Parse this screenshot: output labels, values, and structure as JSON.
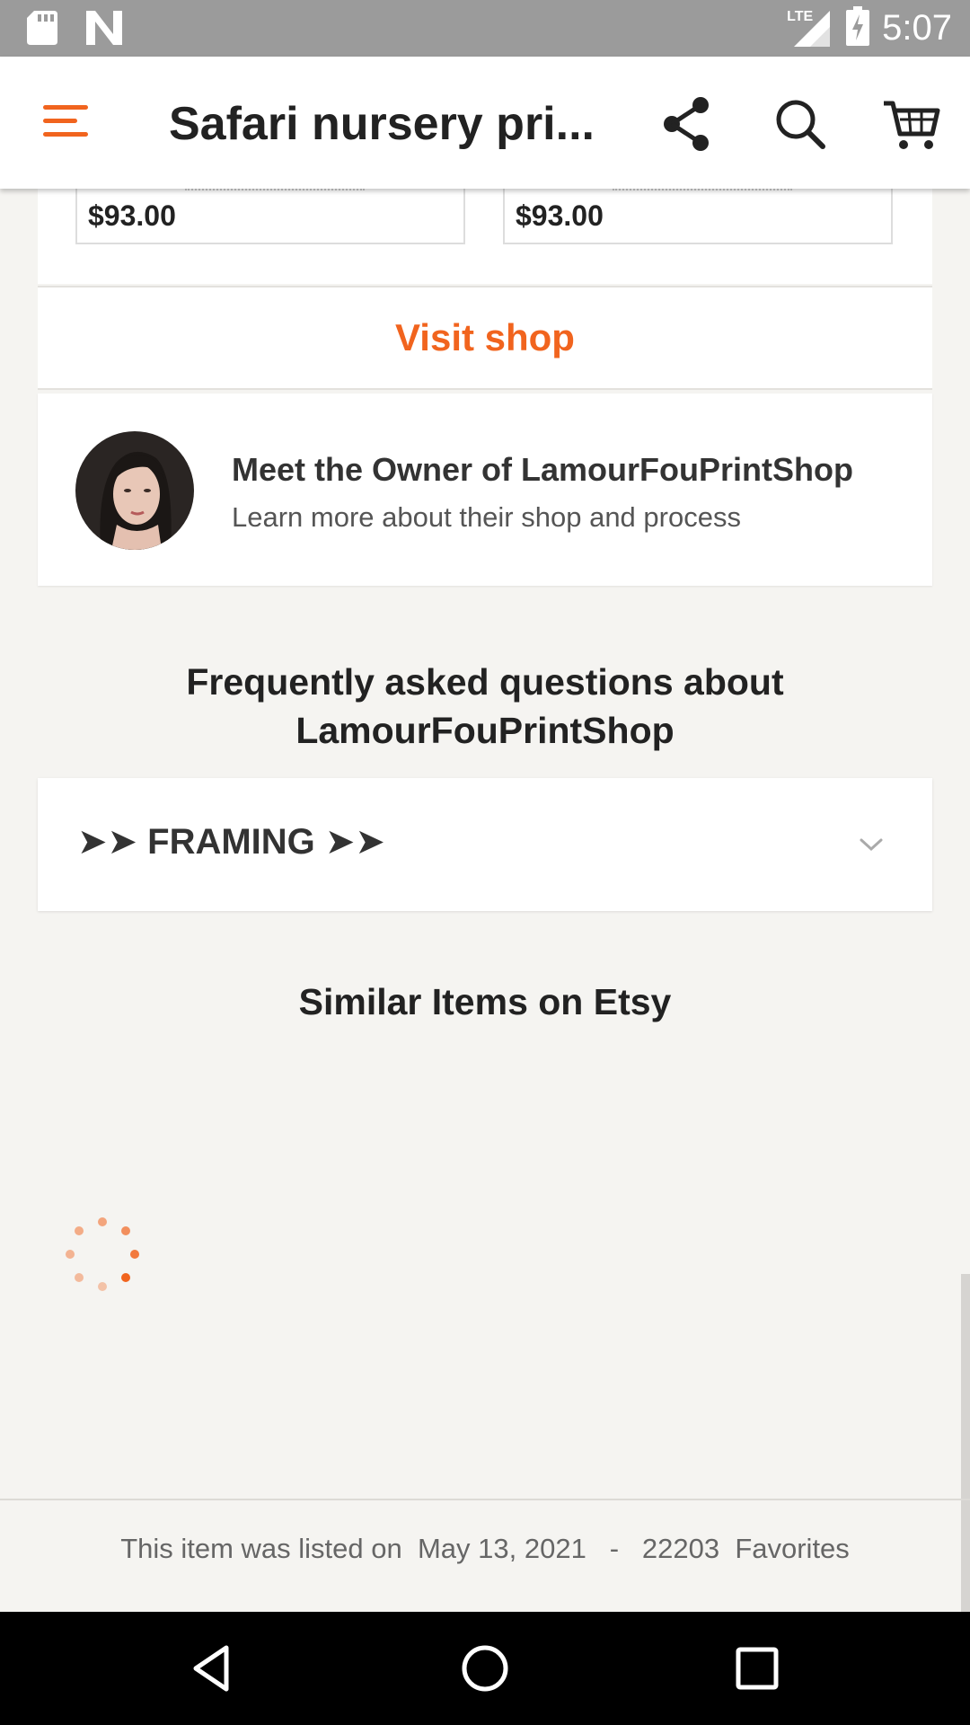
{
  "status_bar": {
    "time": "5:07",
    "network": "LTE",
    "icons": [
      "sd-card-icon",
      "n-notification-icon",
      "signal-icon",
      "battery-charging-icon"
    ]
  },
  "app_bar": {
    "title": "Safari nursery pri...",
    "icons": [
      "menu-icon",
      "share-icon",
      "search-icon",
      "cart-icon"
    ],
    "accent": "#f1641e"
  },
  "listing_cards": [
    {
      "price": "$93.00"
    },
    {
      "price": "$93.00"
    }
  ],
  "shop": {
    "visit_label": "Visit shop",
    "owner_title": "Meet the Owner of LamourFouPrintShop",
    "owner_subtitle": "Learn more about their shop and process"
  },
  "faq": {
    "heading": "Frequently asked questions about LamourFouPrintShop",
    "items": [
      {
        "label": "➤➤ FRAMING ➤➤"
      }
    ]
  },
  "similar": {
    "heading": "Similar Items on Etsy"
  },
  "footer": {
    "listed_prefix": "This item was listed on",
    "listed_date": "May 13, 2021",
    "separator": "-",
    "favorites_count": "22203",
    "favorites_label": "Favorites"
  },
  "nav": {
    "icons": [
      "back-icon",
      "home-icon",
      "recents-icon"
    ]
  }
}
